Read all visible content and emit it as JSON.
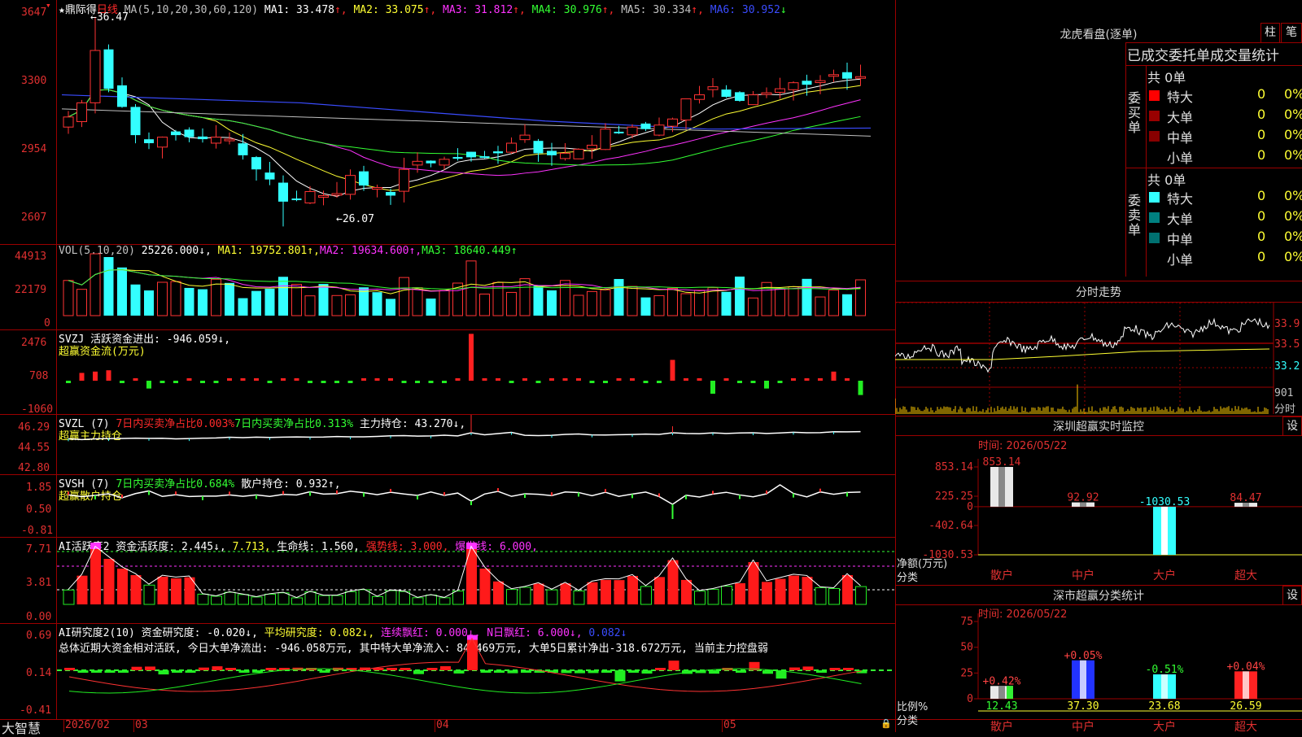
{
  "app": {
    "brand": "大智慧",
    "stock_name": "鼎际得",
    "period": "日线"
  },
  "kline": {
    "ma_label": "MA(5,10,20,30,60,120)",
    "ma": [
      {
        "name": "MA1:",
        "value": "33.478",
        "arrow": "↑",
        "color": "#ffffff"
      },
      {
        "name": "MA2:",
        "value": "33.075",
        "arrow": "↑",
        "color": "#ffff33"
      },
      {
        "name": "MA3:",
        "value": "31.812",
        "arrow": "↑",
        "color": "#ff33ff"
      },
      {
        "name": "MA4:",
        "value": "30.976",
        "arrow": "↑",
        "color": "#33ff33"
      },
      {
        "name": "MA5:",
        "value": "30.334",
        "arrow": "↑",
        "color": "#c0c0c0"
      },
      {
        "name": "MA6:",
        "value": "30.952",
        "arrow": "↓",
        "color": "#3a4cff"
      }
    ],
    "y_ticks": [
      "3647",
      "3300",
      "2954",
      "2607"
    ],
    "high_label": "36.47",
    "low_label": "26.07"
  },
  "volume": {
    "label": "VOL(5,10,20)",
    "value": "25226.000↓,",
    "ma": [
      {
        "text": "MA1: 19752.801↑,",
        "color": "#ffff33"
      },
      {
        "text": "MA2: 19634.600↑,",
        "color": "#ff33ff"
      },
      {
        "text": "MA3: 18640.449↑",
        "color": "#33ff33"
      }
    ],
    "y_ticks": [
      "44913",
      "22179",
      "0"
    ]
  },
  "svzj": {
    "line1": "SVZJ  活跃资金进出: -946.059↓,",
    "line2": "超赢资金流(万元)",
    "y_ticks": [
      "2476",
      "708",
      "-1060"
    ]
  },
  "svzl": {
    "name": "SVZL (7)",
    "t1": "7日内买卖净占比0.003%",
    "t2": "7日内买卖净占比0.313%",
    "t3": "主力持仓: 43.270↓,",
    "line2": "超赢主力持仓",
    "y_ticks": [
      "46.29",
      "44.55",
      "42.80"
    ]
  },
  "svsh": {
    "name": "SVSH (7)",
    "t1": "7日内买卖净占比0.684%",
    "t2": "散户持仓: 0.932↑,",
    "line2": "超赢散户持仓",
    "y_ticks": [
      "1.85",
      "0.50",
      "-0.81"
    ]
  },
  "ai1": {
    "name": "AI活跃度2",
    "t1": "资金活跃度: 2.445↓,",
    "t2": "7.713,",
    "t3": "生命线: 1.560,",
    "t4": "强势线: 3.000,",
    "t5": "爆发线: 6.000,",
    "y_ticks": [
      "7.71",
      "3.81",
      "0.00"
    ]
  },
  "ai2": {
    "name": "AI研究度2(10)",
    "t1": "资金研究度: -0.020↓,",
    "t2": "平均研究度: 0.082↓,",
    "t3": "连续飘红: 0.000↓,",
    "t4": "N日飘红: 6.000↓,",
    "t5": "0.082↓",
    "summary": "总体近期大资金相对活跃, 今日大单净流出: -946.058万元, 其中特大单净流入: 84.469万元, 大单5日累计净出-318.672万元, 当前主力控盘弱",
    "y_ticks": [
      "0.69",
      "0.14",
      "-0.41"
    ]
  },
  "xaxis": {
    "labels": [
      "2026/02",
      "03",
      "04",
      "05"
    ]
  },
  "longhu": {
    "title": "龙虎看盘(逐单)",
    "btn1": "柱",
    "btn2": "笔",
    "header": "已成交委托单成交量统计",
    "buy_label": "委买单",
    "sell_label": "委卖单",
    "buy_total": "共 0单",
    "sell_total": "共 0单",
    "buy_rows": [
      {
        "name": "特大",
        "v1": "0",
        "v2": "0%",
        "color": "#ff0000"
      },
      {
        "name": "大单",
        "v1": "0",
        "v2": "0%",
        "color": "#990000"
      },
      {
        "name": "中单",
        "v1": "0",
        "v2": "0%",
        "color": "#880000"
      },
      {
        "name": "小单",
        "v1": "0",
        "v2": "0%",
        "color": ""
      }
    ],
    "sell_rows": [
      {
        "name": "特大",
        "v1": "0",
        "v2": "0%",
        "color": "#33ffff"
      },
      {
        "name": "大单",
        "v1": "0",
        "v2": "0%",
        "color": "#008080"
      },
      {
        "name": "中单",
        "v1": "0",
        "v2": "0%",
        "color": "#007070"
      },
      {
        "name": "小单",
        "v1": "0",
        "v2": "0%",
        "color": ""
      }
    ]
  },
  "fenshi": {
    "title": "分时走势",
    "y_ticks": [
      "33.9",
      "33.5",
      "33.2"
    ],
    "vol_tick": "901",
    "vol_unit": "分时"
  },
  "sz_monitor": {
    "title": "深圳超赢实时监控",
    "btn": "设",
    "time": "时间: 2026/05/22",
    "y_ticks": [
      "853.14",
      "225.25",
      "0",
      "-402.64",
      "-1030.53"
    ],
    "ylabel": "净额(万元)",
    "xlabel": "分类",
    "categories": [
      "散户",
      "中户",
      "大户",
      "超大"
    ]
  },
  "sh_stats": {
    "title": "深市超赢分类统计",
    "btn": "设",
    "time": "时间: 2026/05/22",
    "y_ticks": [
      "75",
      "50",
      "25",
      "0"
    ],
    "ylabel": "比例%",
    "xlabel": "分类",
    "categories": [
      "散户",
      "中户",
      "大户",
      "超大"
    ]
  },
  "chart_data": [
    {
      "type": "bar",
      "title": "深圳超赢实时监控",
      "ylabel": "净额(万元)",
      "xlabel": "分类",
      "categories": [
        "散户",
        "中户",
        "大户",
        "超大"
      ],
      "values": [
        853.14,
        92.92,
        -1030.53,
        84.47
      ],
      "value_labels": [
        "853.14",
        "92.92",
        "-1030.53",
        "84.47"
      ],
      "ylim": [
        -1030.53,
        853.14
      ]
    },
    {
      "type": "bar",
      "title": "深市超赢分类统计",
      "ylabel": "比例%",
      "xlabel": "分类",
      "categories": [
        "散户",
        "中户",
        "大户",
        "超大"
      ],
      "values": [
        12.43,
        37.3,
        23.68,
        26.59
      ],
      "value_labels": [
        "12.43",
        "37.30",
        "23.68",
        "26.59"
      ],
      "change_labels": [
        "+0.42%",
        "+0.05%",
        "-0.51%",
        "+0.04%"
      ],
      "ylim": [
        0,
        75
      ]
    }
  ]
}
